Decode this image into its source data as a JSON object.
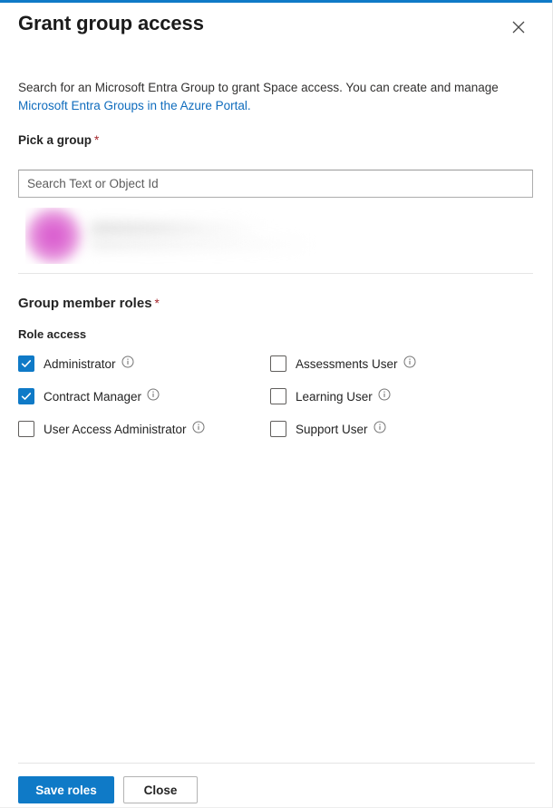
{
  "theme": {
    "accent_bar_color": "#0f7ac7",
    "primary_button_color": "#0f7ac7",
    "link_color": "#0f6cbd",
    "required_asterisk_color": "#a4262c",
    "checkbox_checked_color": "#0f7ac7",
    "avatar_color": "#d857cd"
  },
  "header": {
    "title": "Grant group access",
    "close_icon": "close-icon"
  },
  "description": {
    "text_before_link": "Search for an Microsoft Entra Group to grant Space access. You can create and manage ",
    "link_text": "Microsoft Entra Groups in the Azure Portal."
  },
  "pick_a_group": {
    "label": "Pick a group",
    "required": "*",
    "search_placeholder": "Search Text or Object Id",
    "search_value": "",
    "selected_group": {
      "redacted": true,
      "avatar_icon": "group-avatar-icon",
      "name": "",
      "meta": ""
    }
  },
  "roles_section": {
    "label": "Group member roles",
    "required": "*",
    "subheading": "Role access",
    "info_icon": "info-icon",
    "roles": [
      {
        "label": "Administrator",
        "checked": true,
        "column": 1,
        "row": 1
      },
      {
        "label": "Assessments User",
        "checked": false,
        "column": 2,
        "row": 1
      },
      {
        "label": "Contract Manager",
        "checked": true,
        "column": 1,
        "row": 2
      },
      {
        "label": "Learning User",
        "checked": false,
        "column": 2,
        "row": 2
      },
      {
        "label": "User Access Administrator",
        "checked": false,
        "column": 1,
        "row": 3
      },
      {
        "label": "Support User",
        "checked": false,
        "column": 2,
        "row": 3
      }
    ]
  },
  "footer": {
    "save_label": "Save roles",
    "close_label": "Close"
  }
}
